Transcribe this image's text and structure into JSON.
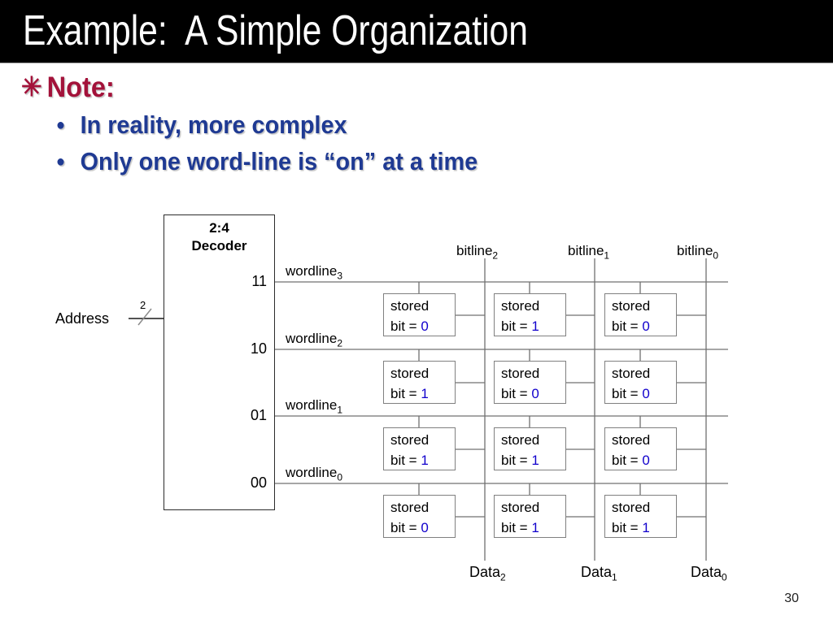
{
  "slide": {
    "title": "Example:  A Simple Organization",
    "page_number": "30",
    "title_bg": "#000000",
    "title_fg": "#ffffff",
    "accent_red": "#A3123A",
    "accent_blue": "#1F3A93",
    "bit_color": "#1100CC"
  },
  "bullets": {
    "level1": {
      "marker": "✳",
      "text": "Note:"
    },
    "level2": [
      {
        "marker": "●",
        "text": "In reality, more complex"
      },
      {
        "marker": "●",
        "text": "Only one word-line is “on” at a time"
      }
    ]
  },
  "diagram": {
    "address_label": "Address",
    "address_bus_width": "2",
    "decoder": {
      "title_line1": "2:4",
      "title_line2": "Decoder",
      "outputs": [
        "11",
        "10",
        "01",
        "00"
      ]
    },
    "wordlines": [
      {
        "name": "wordline",
        "index": "3"
      },
      {
        "name": "wordline",
        "index": "2"
      },
      {
        "name": "wordline",
        "index": "1"
      },
      {
        "name": "wordline",
        "index": "0"
      }
    ],
    "bitlines": [
      {
        "name": "bitline",
        "index": "2"
      },
      {
        "name": "bitline",
        "index": "1"
      },
      {
        "name": "bitline",
        "index": "0"
      }
    ],
    "data_outputs": [
      {
        "name": "Data",
        "index": "2"
      },
      {
        "name": "Data",
        "index": "1"
      },
      {
        "name": "Data",
        "index": "0"
      }
    ],
    "cell_label_line1": "stored",
    "cell_label_line2_prefix": "bit = ",
    "memory_matrix": {
      "row_labels": [
        "wordline3",
        "wordline2",
        "wordline1",
        "wordline0"
      ],
      "column_labels": [
        "bitline2",
        "bitline1",
        "bitline0"
      ],
      "bits": [
        [
          "0",
          "1",
          "0"
        ],
        [
          "1",
          "0",
          "0"
        ],
        [
          "1",
          "1",
          "0"
        ],
        [
          "0",
          "1",
          "1"
        ]
      ]
    }
  }
}
